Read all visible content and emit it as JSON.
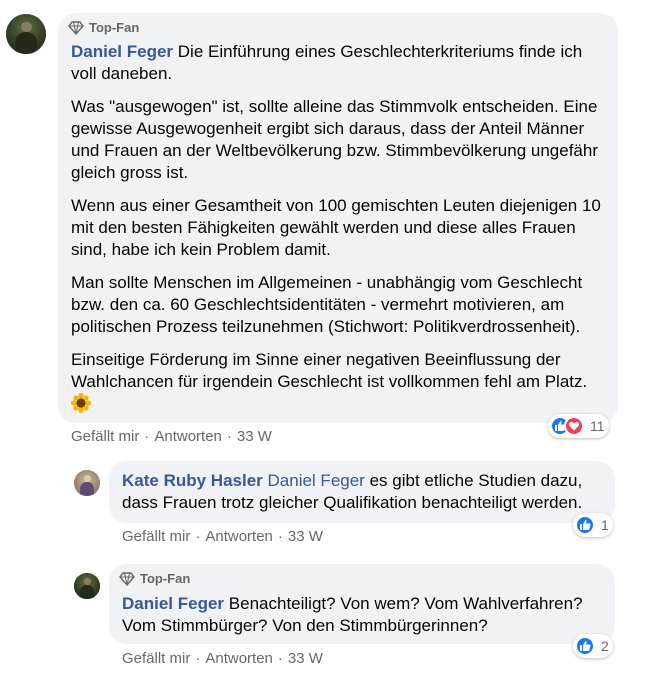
{
  "comments": [
    {
      "badge": "Top-Fan",
      "author": "Daniel Feger",
      "paragraphs": [
        "Die Einführung eines Geschlechterkriteriums finde ich voll daneben.",
        "Was \"ausgewogen\" ist, sollte alleine das Stimmvolk entscheiden. Eine gewisse Ausgewogenheit ergibt sich daraus, dass der Anteil Männer und Frauen an der Weltbevölkerung bzw. Stimmbevölkerung ungefähr gleich gross ist.",
        "Wenn aus einer Gesamtheit von 100 gemischten Leuten diejenigen 10 mit den besten Fähigkeiten gewählt werden und diese alles Frauen sind, habe ich kein Problem damit.",
        "Man sollte Menschen im Allgemeinen - unabhängig vom Geschlecht bzw. den ca. 60 Geschlechtsidentitäten - vermehrt motivieren, am politischen Prozess teilzunehmen (Stichwort: Politikverdrossenheit).",
        "Einseitige Förderung im Sinne einer negativen Beeinflussung der Wahlchancen für irgendein Geschlecht ist vollkommen fehl am Platz."
      ],
      "emoji": "sunflower",
      "actions": {
        "like": "Gefällt mir",
        "reply": "Antworten",
        "time": "33 W"
      },
      "reactions": {
        "icons": [
          "like",
          "love"
        ],
        "count": "11"
      }
    },
    {
      "author": "Kate Ruby Hasler",
      "mention": "Daniel Feger",
      "text": "es gibt etliche Studien dazu, dass Frauen trotz gleicher Qualifikation benachteiligt werden.",
      "actions": {
        "like": "Gefällt mir",
        "reply": "Antworten",
        "time": "33 W"
      },
      "reactions": {
        "icons": [
          "like"
        ],
        "count": "1"
      }
    },
    {
      "badge": "Top-Fan",
      "author": "Daniel Feger",
      "text": "Benachteiligt? Von wem? Vom Wahlverfahren? Vom Stimmbürger? Von den Stimmbürgerinnen?",
      "actions": {
        "like": "Gefällt mir",
        "reply": "Antworten",
        "time": "33 W"
      },
      "reactions": {
        "icons": [
          "like"
        ],
        "count": "2"
      }
    }
  ],
  "colors": {
    "link": "#385898",
    "bubble": "#f0f2f5",
    "like": "#1877f2",
    "love": "#f33e58",
    "meta": "#65676b"
  },
  "icons": {
    "badge": "diamond-icon",
    "like": "thumbs-up-icon",
    "love": "heart-icon"
  }
}
